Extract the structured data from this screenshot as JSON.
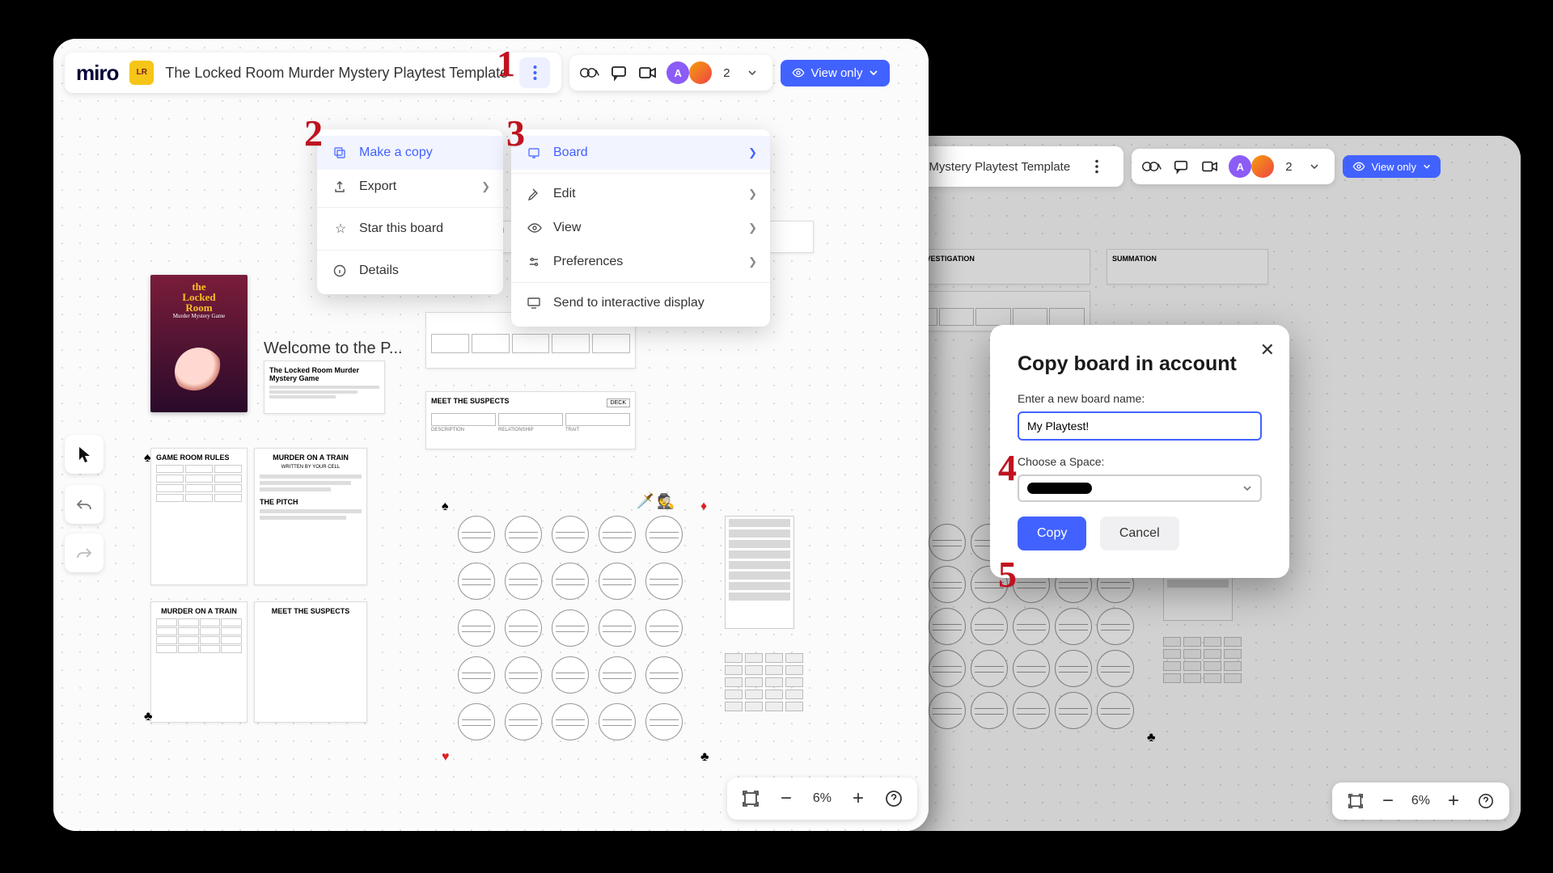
{
  "callouts": {
    "c1": "1",
    "c2": "2",
    "c3": "3",
    "c4": "4",
    "c5": "5"
  },
  "board": {
    "app": "miro",
    "title": "The Locked Room Murder Mystery Playtest Template",
    "welcome": "Welcome to the P...",
    "participants": "2",
    "view_mode": "View only",
    "zoom": "6%",
    "cards": {
      "investigation": "THE INVESTIGATION",
      "summation": "SUMMATION",
      "suspects": "MEET THE SUSPECTS",
      "murder_train": "MURDER ON A TRAIN",
      "subhead": "WRITTEN BY YOUR CELL",
      "pitch": "THE PITCH",
      "locked_room": "THE LOCKED ROOM MURDER",
      "game_rules": "GAME ROOM RULES",
      "intro_card": "The Locked Room Murder Mystery Game",
      "deck": "DECK",
      "suspect_cols": {
        "a": "DESCRIPTION",
        "b": "RELATIONSHIP",
        "c": "TRAIT"
      }
    }
  },
  "menu1": {
    "make_copy": "Make a copy",
    "export": "Export",
    "star": "Star this board",
    "details": "Details"
  },
  "menu2": {
    "board": "Board",
    "edit": "Edit",
    "view": "View",
    "preferences": "Preferences",
    "send": "Send to interactive display"
  },
  "dialog": {
    "title": "Copy board in account",
    "name_label": "Enter a new board name:",
    "name_value": "My Playtest!",
    "space_label": "Choose a Space:",
    "copy": "Copy",
    "cancel": "Cancel"
  }
}
